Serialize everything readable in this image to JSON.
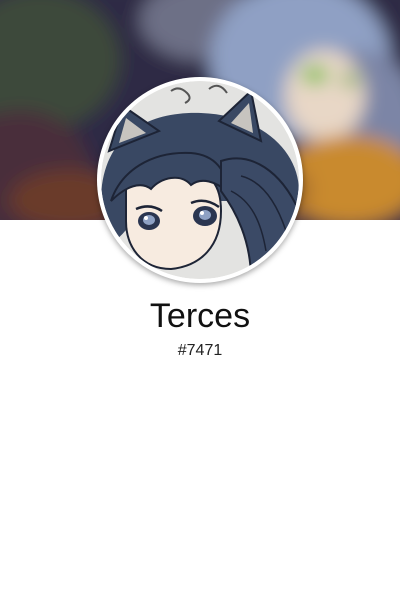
{
  "profile": {
    "username": "Terces",
    "discriminator": "#7471",
    "banner_image": "blurred-anime-character-banner",
    "avatar_image": "anime-cat-girl-avatar"
  },
  "colors": {
    "background": "#ffffff",
    "avatar_border": "#ffffff",
    "banner_dark": "#2e2b45",
    "banner_hair": "#8fa0c4",
    "banner_eye": "#7ac043",
    "banner_orange": "#c98a2e",
    "avatar_hair": "#394863",
    "avatar_bg": "#e3e3e1"
  }
}
